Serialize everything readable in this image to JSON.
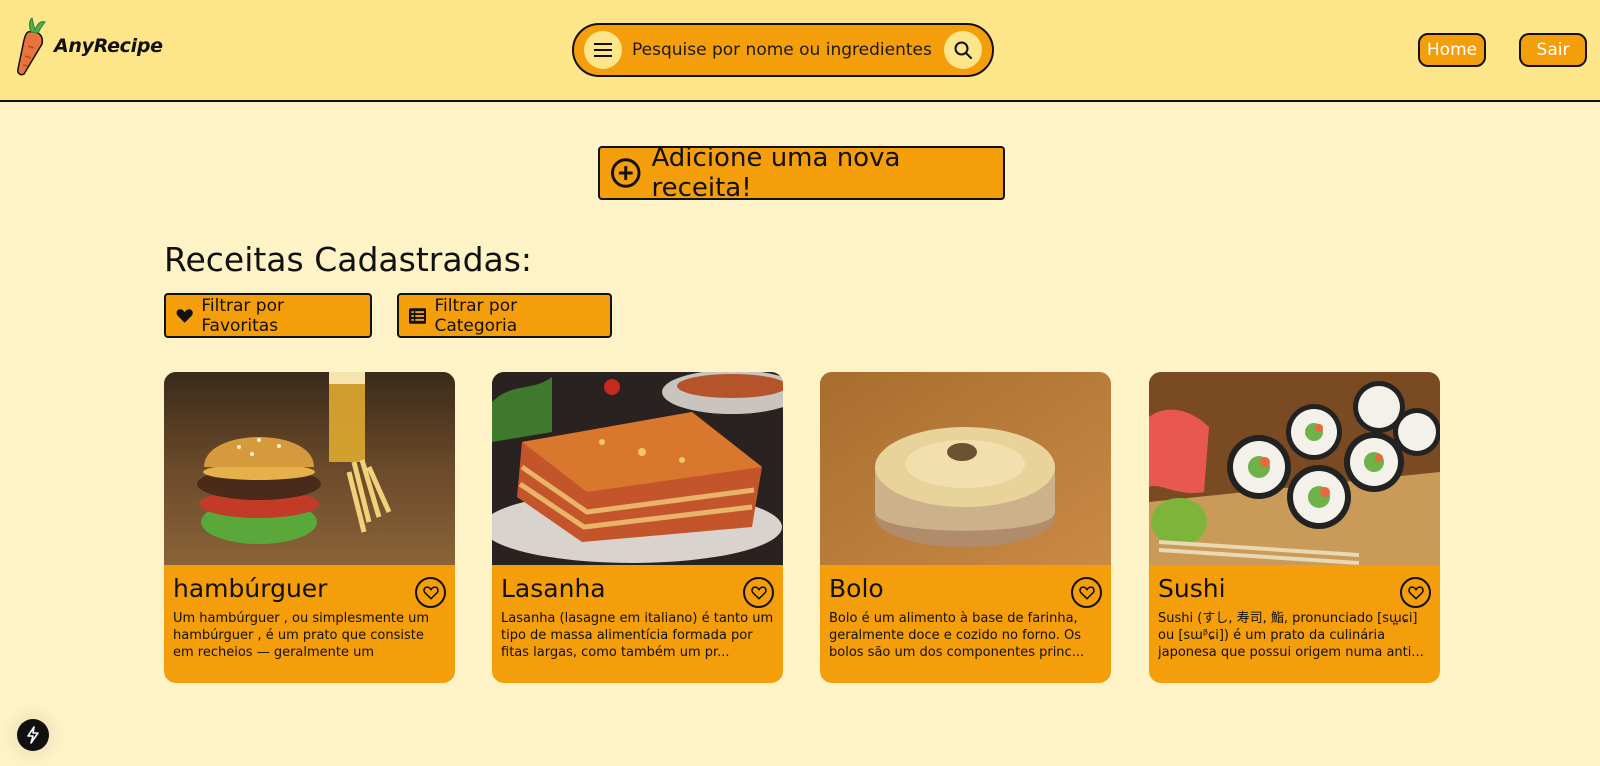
{
  "header": {
    "app_name": "AnyRecipe",
    "search": {
      "placeholder": "Pesquise por nome ou ingredientes",
      "value": ""
    },
    "nav": {
      "home": "Home",
      "logout": "Sair"
    }
  },
  "main": {
    "add_recipe_label": "Adicione uma nova receita!",
    "section_title": "Receitas Cadastradas:",
    "filters": {
      "favorites": "Filtrar por Favoritas",
      "category": "Filtrar por Categoria"
    },
    "recipes": [
      {
        "title": "hambúrguer",
        "description": "Um hambúrguer , ou simplesmente um hambúrguer , é um prato que consiste em recheios — geralmente um hambúrguer..."
      },
      {
        "title": "Lasanha",
        "description": "Lasanha (lasagne em italiano) é tanto um tipo de massa alimentícia formada por fitas largas, como também um pr..."
      },
      {
        "title": "Bolo",
        "description": "Bolo é um alimento à base de farinha, geralmente doce e cozido no forno. Os bolos são um dos componentes princ..."
      },
      {
        "title": "Sushi",
        "description": "Sushi (すし, 寿司, 鮨, pronunciado [sɯ͍ɕi] ou [sɯᵝɕi]) é um prato da culinária japonesa que possui origem numa anti..."
      }
    ]
  },
  "colors": {
    "header_bg": "#fde68a",
    "page_bg": "#fef3c7",
    "accent": "#f59e0b"
  },
  "icons": [
    "carrot-logo",
    "menu-icon",
    "search-icon",
    "plus-circle-icon",
    "heart-icon",
    "list-icon",
    "heart-outline-icon",
    "bolt-icon"
  ]
}
